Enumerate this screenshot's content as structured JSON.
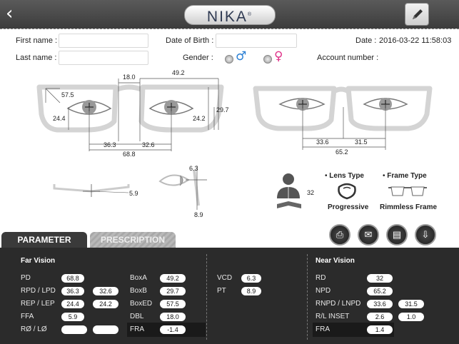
{
  "header": {
    "back_icon": "chevron-left-icon",
    "logo_text": "NIKA",
    "logo_mark": "®",
    "edit_icon": "pencil-icon"
  },
  "form": {
    "first_name_label": "First name :",
    "last_name_label": "Last name :",
    "dob_label": "Date of Birth :",
    "gender_label": "Gender :",
    "date_label": "Date :",
    "date_value": "2016-03-22 11:58:03",
    "account_label": "Account number :",
    "male_symbol": "♂",
    "female_symbol": "♀"
  },
  "measure": {
    "top": "49.2",
    "bridge": "18.0",
    "box_ed": "57.5",
    "left_h": "24.4",
    "right_h": "24.2",
    "height_r": "29.7",
    "pd_l": "36.3",
    "pd_r": "32.6",
    "total": "68.8",
    "near_l": "33.6",
    "near_r": "31.5",
    "near_total": "65.2",
    "tilt": "5.9",
    "vcd": "6.3",
    "vcd2": "8.9",
    "head_val": "32"
  },
  "lens": {
    "lens_type_label": "Lens Type",
    "lens_type_value": "Progressive",
    "frame_type_label": "Frame Type",
    "frame_type_value": "Rimmless Frame"
  },
  "tabs": {
    "parameter": "PARAMETER",
    "prescription": "PRESCRIPTION"
  },
  "actions": [
    {
      "name": "print-icon",
      "glyph": "⎙"
    },
    {
      "name": "mail-icon",
      "glyph": "✉"
    },
    {
      "name": "clipboard-icon",
      "glyph": "▤"
    },
    {
      "name": "download-icon",
      "glyph": "⇩"
    }
  ],
  "far": {
    "title": "Far Vision",
    "rows": [
      {
        "label": "PD",
        "v1": "68.8",
        "v2": ""
      },
      {
        "label": "RPD / LPD",
        "v1": "36.3",
        "v2": "32.6"
      },
      {
        "label": "REP / LEP",
        "v1": "24.4",
        "v2": "24.2"
      },
      {
        "label": "FFA",
        "v1": "5.9",
        "v2": ""
      },
      {
        "label": "RØ / LØ",
        "v1": "",
        "v2": ""
      }
    ]
  },
  "box": {
    "rows": [
      {
        "label": "BoxA",
        "v": "49.2"
      },
      {
        "label": "BoxB",
        "v": "29.7"
      },
      {
        "label": "BoxED",
        "v": "57.5"
      },
      {
        "label": "DBL",
        "v": "18.0"
      },
      {
        "label": "FRA",
        "v": "-1.4"
      }
    ]
  },
  "vcd": {
    "rows": [
      {
        "label": "VCD",
        "v": "6.3"
      },
      {
        "label": "PT",
        "v": "8.9"
      }
    ]
  },
  "near": {
    "title": "Near Vision",
    "rows": [
      {
        "label": "RD",
        "v1": "32",
        "v2": ""
      },
      {
        "label": "NPD",
        "v1": "65.2",
        "v2": ""
      },
      {
        "label": "RNPD / LNPD",
        "v1": "33.6",
        "v2": "31.5"
      },
      {
        "label": "R/L INSET",
        "v1": "2.6",
        "v2": "1.0"
      },
      {
        "label": "FRA",
        "v1": "1.4",
        "v2": ""
      }
    ]
  }
}
